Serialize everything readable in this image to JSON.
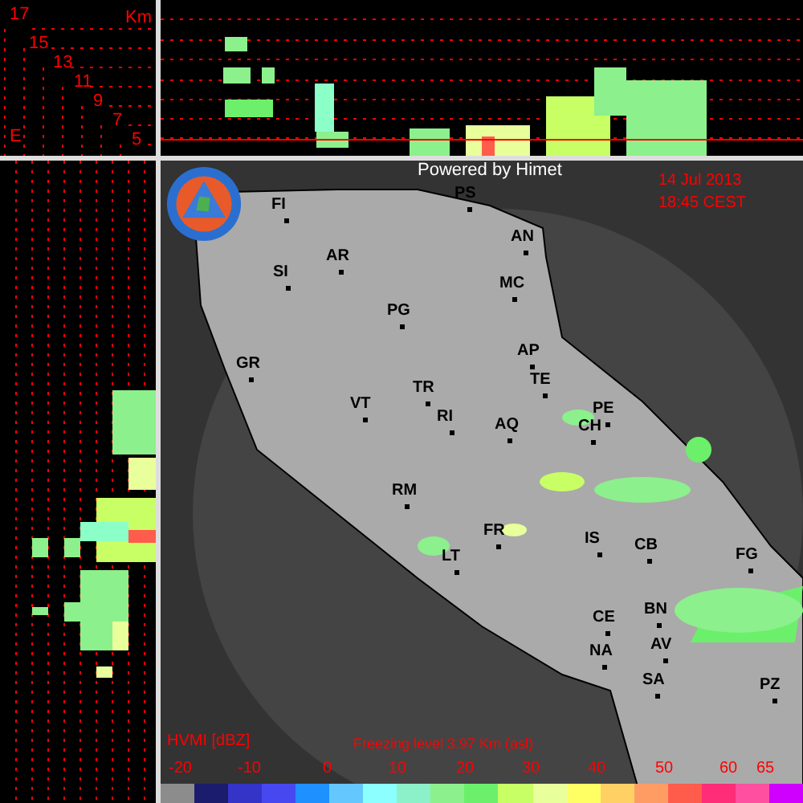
{
  "height_scale": {
    "unit": "Km",
    "levels": [
      "17",
      "15",
      "13",
      "11",
      "9",
      "7",
      "5"
    ],
    "axis_label": "E"
  },
  "map": {
    "credit": "Powered by Himet",
    "date": "14 Jul 2013",
    "time": "18:45 CEST",
    "cities": [
      {
        "label": "FI"
      },
      {
        "label": "PS"
      },
      {
        "label": "AN"
      },
      {
        "label": "SI"
      },
      {
        "label": "AR"
      },
      {
        "label": "MC"
      },
      {
        "label": "PG"
      },
      {
        "label": "GR"
      },
      {
        "label": "AP"
      },
      {
        "label": "TE"
      },
      {
        "label": "TR"
      },
      {
        "label": "VT"
      },
      {
        "label": "RI"
      },
      {
        "label": "AQ"
      },
      {
        "label": "PE"
      },
      {
        "label": "CH"
      },
      {
        "label": "RM"
      },
      {
        "label": "FR"
      },
      {
        "label": "IS"
      },
      {
        "label": "CB"
      },
      {
        "label": "LT"
      },
      {
        "label": "FG"
      },
      {
        "label": "BN"
      },
      {
        "label": "CE"
      },
      {
        "label": "NA"
      },
      {
        "label": "AV"
      },
      {
        "label": "SA"
      },
      {
        "label": "PZ"
      }
    ]
  },
  "legend": {
    "product": "HVMI [dBZ]",
    "freezing_level": "Freezing level  3.97 Km (asl)",
    "ticks": [
      "-20",
      "-10",
      "0",
      "10",
      "20",
      "30",
      "40",
      "50",
      "60",
      "65"
    ],
    "bins": [
      {
        "color": "#8c8c8c"
      },
      {
        "color": "#1c1c6c"
      },
      {
        "color": "#3434c8"
      },
      {
        "color": "#4848f0"
      },
      {
        "color": "#1e90ff"
      },
      {
        "color": "#64c8ff"
      },
      {
        "color": "#8cffff"
      },
      {
        "color": "#8cf0c8"
      },
      {
        "color": "#8cf08c"
      },
      {
        "color": "#6cf06c"
      },
      {
        "color": "#c8ff64"
      },
      {
        "color": "#e8ff9c"
      },
      {
        "color": "#ffff64"
      },
      {
        "color": "#ffd064"
      },
      {
        "color": "#ff9c64"
      },
      {
        "color": "#ff5c4c"
      },
      {
        "color": "#ff2c78"
      },
      {
        "color": "#ff50a0"
      },
      {
        "color": "#d000ff"
      }
    ]
  }
}
